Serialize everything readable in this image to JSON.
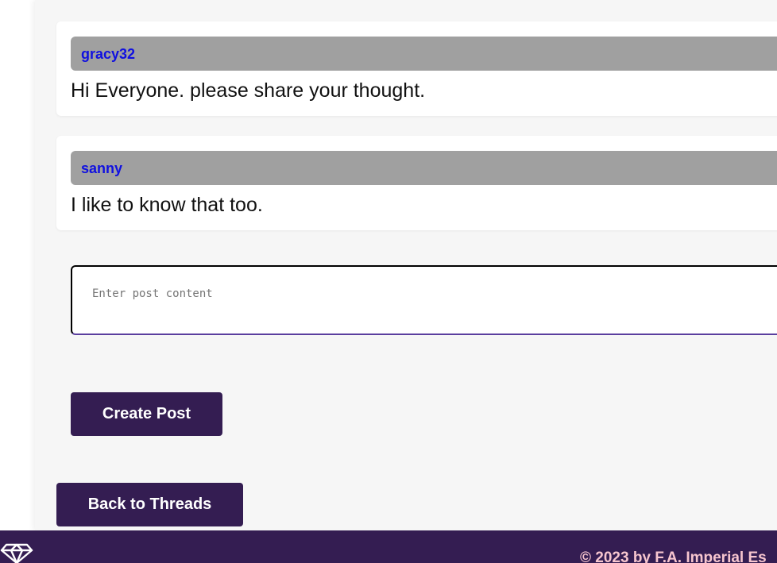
{
  "posts": [
    {
      "author": "gracy32",
      "content": "Hi Everyone. please share your thought."
    },
    {
      "author": "sanny",
      "content": "I like to know that too."
    }
  ],
  "compose": {
    "placeholder": "Enter post content",
    "submit_label": "Create Post"
  },
  "navigation": {
    "back_label": "Back to Threads"
  },
  "footer": {
    "logo_icon": "diamond-logo-icon",
    "copyright": "© 2023 by F.A. Imperial Es"
  },
  "colors": {
    "primary": "#341d52",
    "author_link": "#1010e0",
    "post_header": "#a0a0a0",
    "footer_text": "#f7c6cf"
  }
}
